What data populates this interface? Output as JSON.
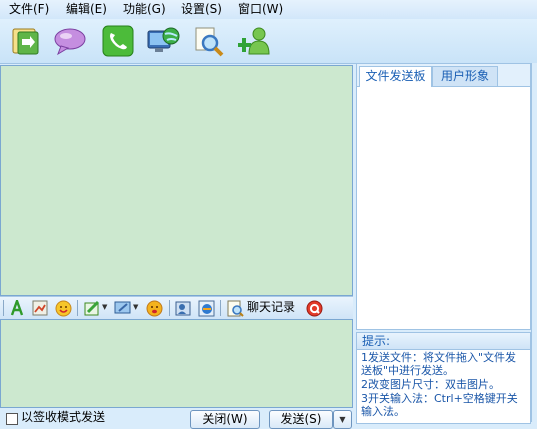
{
  "menu": [
    {
      "label": "文件(F)"
    },
    {
      "label": "编辑(E)"
    },
    {
      "label": "功能(G)"
    },
    {
      "label": "设置(S)"
    },
    {
      "label": "窗口(W)"
    }
  ],
  "toolbar_icons": [
    "transfer-icon",
    "chat-bubble-icon",
    "phone-icon",
    "remote-desktop-icon",
    "search-icon",
    "add-user-icon"
  ],
  "format_bar": {
    "history_label": "聊天记录"
  },
  "bottom": {
    "checkbox_label": "以签收模式发送",
    "close_label": "关闭(W)",
    "send_label": "发送(S)"
  },
  "side_tabs": [
    {
      "label": "文件发送板",
      "active": true
    },
    {
      "label": "用户形象",
      "active": false
    }
  ],
  "tips": {
    "title": "提示:",
    "lines": [
      "1发送文件：将文件拖入\"文件发送板\"中进行发送。",
      "2改变图片尺寸：双击图片。",
      "3开关输入法：Ctrl+空格键开关输入法。"
    ]
  },
  "colors": {
    "chat_bg": "#cce8cf",
    "window_bg": "#d9ecfb",
    "tab_text": "#1a5fb4"
  }
}
